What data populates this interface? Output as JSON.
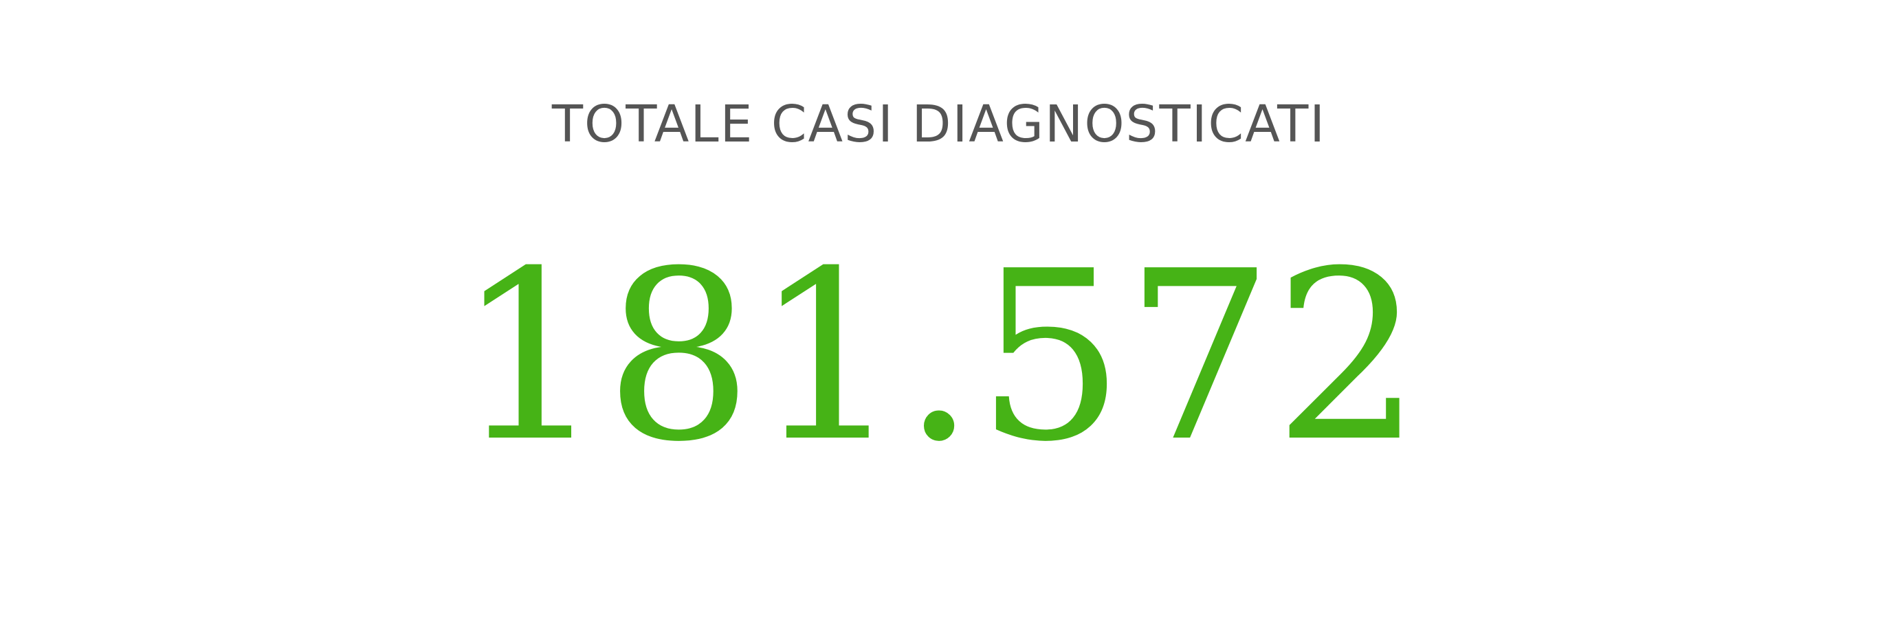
{
  "kpi": {
    "title": "TOTALE CASI DIAGNOSTICATI",
    "value": "181.572",
    "value_color": "#46b316",
    "title_color": "#555555"
  }
}
